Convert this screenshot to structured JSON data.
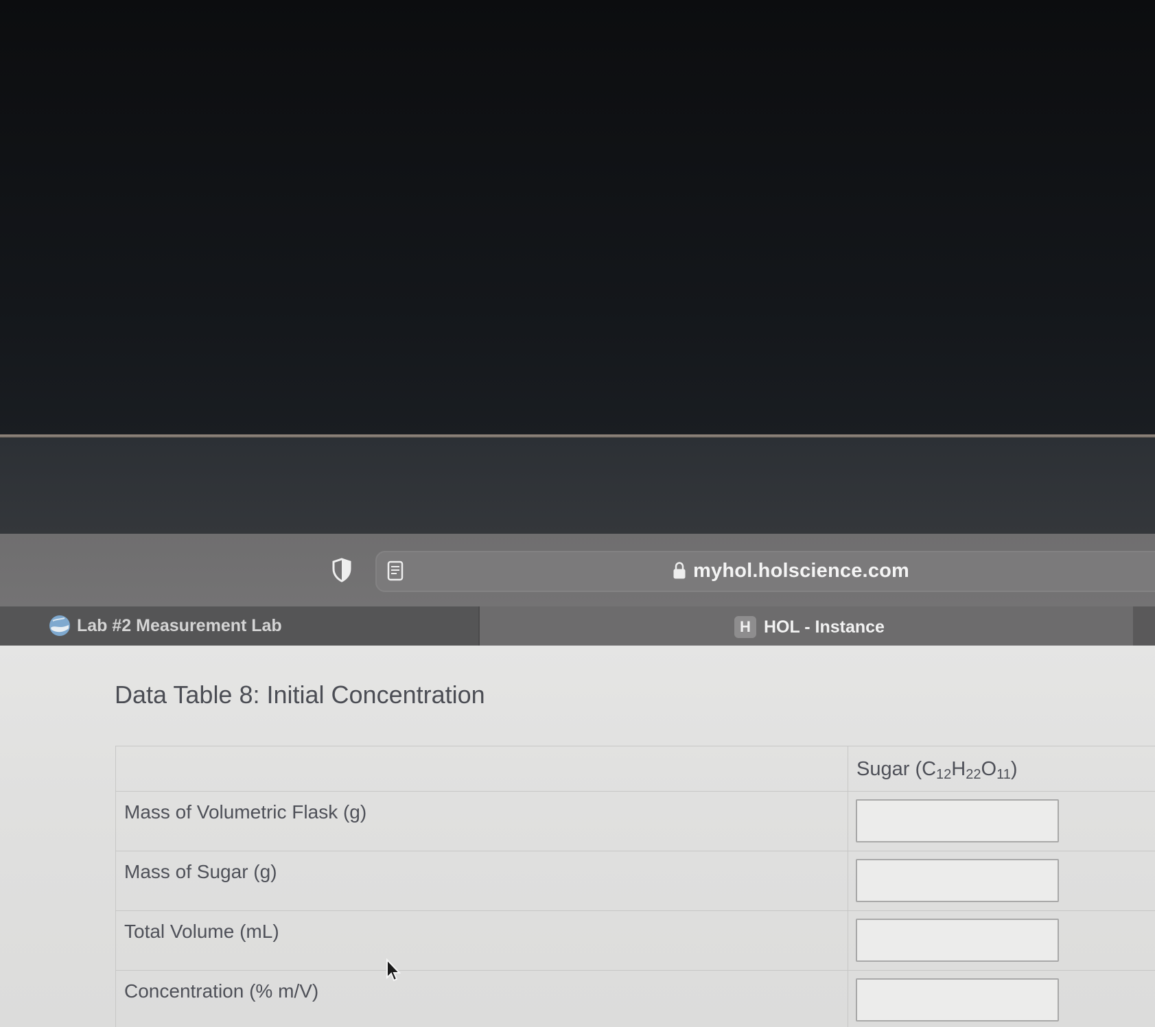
{
  "browser": {
    "url": "myhol.holscience.com",
    "tabs": [
      {
        "label": "Lab #2 Measurement Lab",
        "favicon": "globe-logo-icon",
        "active": false
      },
      {
        "label": "HOL - Instance",
        "favicon_letter": "H",
        "active": true
      }
    ]
  },
  "page": {
    "title": "Data Table 8: Initial Concentration",
    "table": {
      "header": {
        "label": "",
        "column": {
          "prefix": "Sugar (C",
          "sub1": "12",
          "mid1": "H",
          "sub2": "22",
          "mid2": "O",
          "sub3": "11",
          "suffix": ")"
        }
      },
      "rows": [
        {
          "label": "Mass of Volumetric Flask (g)",
          "value": ""
        },
        {
          "label": "Mass of Sugar (g)",
          "value": ""
        },
        {
          "label": "Total Volume (mL)",
          "value": ""
        },
        {
          "label": "Concentration (% m/V)",
          "value": ""
        }
      ]
    }
  },
  "colors": {
    "page_background": "#e0e0df",
    "toolbar_background": "#727172",
    "title_text": "#4b4d54"
  }
}
